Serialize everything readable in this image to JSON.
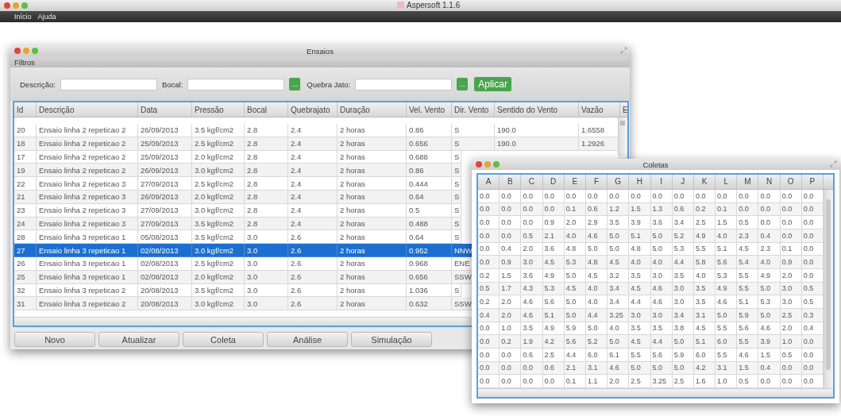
{
  "app": {
    "title": "Aspersoft 1.1.6"
  },
  "menu": [
    "Início",
    "Ajuda"
  ],
  "ensaios": {
    "title": "Ensaios",
    "filter_heading": "Filtros",
    "filters": [
      {
        "label": "Descrição:"
      },
      {
        "label": "Bocal:",
        "button": "..."
      },
      {
        "label": "Quebra Jato:",
        "button": "..."
      }
    ],
    "apply_button": "Aplicar",
    "table": {
      "columns": [
        "Id",
        "Descrição",
        "Data",
        "Pressão",
        "Bocal",
        "Quebrajato",
        "Duração",
        "Vel. Vento",
        "Dir. Vento",
        "Sentido do Vento",
        "Vazão",
        "E"
      ],
      "rows": [
        {
          "selected": false,
          "cells": [
            "20",
            "Ensaio linha 2 repeticao 2",
            "26/09/2013",
            "3.5 kgf/cm2",
            "2.8",
            "2.4",
            "2 horas",
            "0.86",
            "S",
            "190.0",
            "1.6558"
          ]
        },
        {
          "selected": false,
          "cells": [
            "18",
            "Ensaio linha 2 repeticao 2",
            "25/09/2013",
            "2.5 kgf/cm2",
            "2.8",
            "2.4",
            "2 horas",
            "0.656",
            "S",
            "190.0",
            "1.2926"
          ]
        },
        {
          "selected": false,
          "cells": [
            "17",
            "Ensaio linha 2 repeticao 2",
            "25/09/2013",
            "2.0 kgf/cm2",
            "2.8",
            "2.4",
            "2 horas",
            "0.688",
            "S"
          ]
        },
        {
          "selected": false,
          "cells": [
            "19",
            "Ensaio linha 2 repeticao 2",
            "26/09/2013",
            "3.0 kgf/cm2",
            "2.8",
            "2.4",
            "2 horas",
            "0.86",
            "S"
          ]
        },
        {
          "selected": false,
          "cells": [
            "22",
            "Ensaio linha 2 repeticao 3",
            "27/09/2013",
            "2.5 kgf/cm2",
            "2.8",
            "2.4",
            "2 horas",
            "0.444",
            "S"
          ]
        },
        {
          "selected": false,
          "cells": [
            "21",
            "Ensaio linha 2 repeticao 3",
            "26/09/2013",
            "2.0 kgf/cm2",
            "2.8",
            "2.4",
            "2 horas",
            "0.64",
            "S"
          ]
        },
        {
          "selected": false,
          "cells": [
            "23",
            "Ensaio linha 2 repeticao 3",
            "27/09/2013",
            "3.0 kgf/cm2",
            "2.8",
            "2.4",
            "2 horas",
            "0.5",
            "S"
          ]
        },
        {
          "selected": false,
          "cells": [
            "24",
            "Ensaio linha 2 repeticao 3",
            "27/09/2013",
            "3.5 kgf/cm2",
            "2.8",
            "2.4",
            "2 horas",
            "0.488",
            "S"
          ]
        },
        {
          "selected": false,
          "cells": [
            "28",
            "Ensaio linha 3 repeticao 1",
            "05/08/2013",
            "3.5 kgf/cm2",
            "3.0",
            "2.6",
            "2 horas",
            "0.64",
            "S"
          ]
        },
        {
          "selected": true,
          "cells": [
            "27",
            "Ensaio linha 3 repeticao 1",
            "02/08/2013",
            "3.0 kgf/cm2",
            "3.0",
            "2.6",
            "2 horas",
            "0.952",
            "NNW"
          ]
        },
        {
          "selected": false,
          "cells": [
            "26",
            "Ensaio linha 3 repeticao 1",
            "02/08/2013",
            "2.5 kgf/cm2",
            "3.0",
            "2.6",
            "2 horas",
            "0.968",
            "ENE"
          ]
        },
        {
          "selected": false,
          "cells": [
            "25",
            "Ensaio linha 3 repeticao 1",
            "02/08/2013",
            "2.0 kgf/cm2",
            "3.0",
            "2.6",
            "2 horas",
            "0.656",
            "SSW"
          ]
        },
        {
          "selected": false,
          "cells": [
            "32",
            "Ensaio linha 3 repeticao 2",
            "20/08/2013",
            "3.5 kgf/cm2",
            "3.0",
            "2.6",
            "2 horas",
            "1.036",
            "S"
          ]
        },
        {
          "selected": false,
          "cells": [
            "31",
            "Ensaio linha 3 repeticao 2",
            "20/08/2013",
            "3.0 kgf/cm2",
            "3.0",
            "2.6",
            "2 horas",
            "0.632",
            "SSW"
          ]
        }
      ]
    },
    "buttons": [
      "Novo",
      "Atualizar",
      "Coleta",
      "Análise",
      "Simulação"
    ]
  },
  "coletas": {
    "title": "Coletas",
    "table": {
      "columns": [
        "A",
        "B",
        "C",
        "D",
        "E",
        "F",
        "G",
        "H",
        "I",
        "J",
        "K",
        "L",
        "M",
        "N",
        "O",
        "P"
      ],
      "rows": [
        [
          "0.0",
          "0.0",
          "0.0",
          "0.0",
          "0.0",
          "0.0",
          "0.0",
          "0.0",
          "0.0",
          "0.0",
          "0.0",
          "0.0",
          "0.0",
          "0.0",
          "0.0",
          "0.0"
        ],
        [
          "0.0",
          "0.0",
          "0.0",
          "0.0",
          "0.1",
          "0.6",
          "1.2",
          "1.5",
          "1.3",
          "0.6",
          "0.2",
          "0.1",
          "0.0",
          "0.0",
          "0.0",
          "0.0"
        ],
        [
          "0.0",
          "0.0",
          "0.0",
          "0.9",
          "2.0",
          "2.9",
          "3.5",
          "3.9",
          "3.6",
          "3.4",
          "2.5",
          "1.5",
          "0.5",
          "0.0",
          "0.0",
          "0.0"
        ],
        [
          "0.0",
          "0.0",
          "0.5",
          "2.1",
          "4.0",
          "4.6",
          "5.0",
          "5.1",
          "5.0",
          "5.2",
          "4.9",
          "4.0",
          "2.3",
          "0.4",
          "0.0",
          "0.0"
        ],
        [
          "0.0",
          "0.4",
          "2.0",
          "3.6",
          "4.8",
          "5.0",
          "5.0",
          "4.8",
          "5.0",
          "5.3",
          "5.5",
          "5.1",
          "4.5",
          "2.3",
          "0.1",
          "0.0"
        ],
        [
          "0.0",
          "0.9",
          "3.0",
          "4.5",
          "5.3",
          "4.8",
          "4.5",
          "4.0",
          "4.0",
          "4.4",
          "5.8",
          "5.6",
          "5.4",
          "4.0",
          "0.9",
          "0.0"
        ],
        [
          "0.2",
          "1.5",
          "3.6",
          "4.9",
          "5.0",
          "4.5",
          "3.2",
          "3.5",
          "3.0",
          "3.5",
          "4.0",
          "5.3",
          "5.5",
          "4.9",
          "2.0",
          "0.0"
        ],
        [
          "0.5",
          "1.7",
          "4.3",
          "5.3",
          "4.5",
          "4.0",
          "3.4",
          "4.5",
          "4.6",
          "3.0",
          "3.5",
          "4.9",
          "5.5",
          "5.0",
          "3.0",
          "0.5"
        ],
        [
          "0.2",
          "2.0",
          "4.6",
          "5.6",
          "5.0",
          "4.0",
          "3.4",
          "4.4",
          "4.6",
          "3.0",
          "3.5",
          "4.6",
          "5.1",
          "5.3",
          "3.0",
          "0.5"
        ],
        [
          "0.4",
          "2.0",
          "4.6",
          "5.1",
          "5.0",
          "4.4",
          "3.25",
          "3.0",
          "3.0",
          "3.4",
          "3.1",
          "5.0",
          "5.9",
          "5.0",
          "2.5",
          "0.3"
        ],
        [
          "0.0",
          "1.0",
          "3.5",
          "4.9",
          "5.9",
          "5.0",
          "4.0",
          "3.5",
          "3.5",
          "3.8",
          "4.5",
          "5.5",
          "5.6",
          "4.6",
          "2.0",
          "0.4"
        ],
        [
          "0.0",
          "0.2",
          "1.9",
          "4.2",
          "5.6",
          "5.2",
          "5.0",
          "4.5",
          "4.4",
          "5.0",
          "5.1",
          "6.0",
          "5.5",
          "3.9",
          "1.0",
          "0.0"
        ],
        [
          "0.0",
          "0.0",
          "0.6",
          "2.5",
          "4.4",
          "6.0",
          "6.1",
          "5.5",
          "5.6",
          "5.9",
          "6.0",
          "5.5",
          "4.6",
          "1.5",
          "0.5",
          "0.0"
        ],
        [
          "0.0",
          "0.0",
          "0.0",
          "0.6",
          "2.1",
          "3.1",
          "4.6",
          "5.0",
          "5.0",
          "5.0",
          "4.2",
          "3.1",
          "1.5",
          "0.4",
          "0.0",
          "0.0"
        ],
        [
          "0.0",
          "0.0",
          "0.0",
          "0.0",
          "0.1",
          "1.1",
          "2.0",
          "2.5",
          "3.25",
          "2.5",
          "1.6",
          "1.0",
          "0.5",
          "0.0",
          "0.0",
          "0.0"
        ]
      ]
    }
  }
}
